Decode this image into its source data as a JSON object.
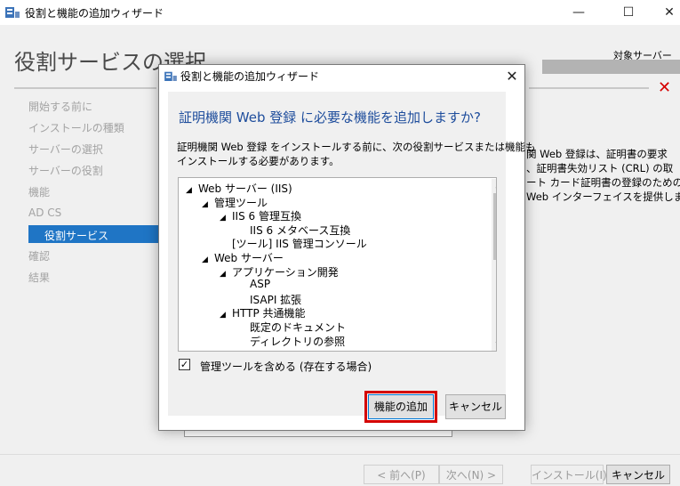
{
  "window": {
    "title": "役割と機能の追加ウィザード",
    "minimize": "—",
    "maximize": "☐",
    "close": "✕"
  },
  "page": {
    "title": "役割サービスの選択",
    "target_server_label": "対象サーバー",
    "error_icon": "✕"
  },
  "nav": {
    "items": [
      "開始する前に",
      "インストールの種類",
      "サーバーの選択",
      "サーバーの役割",
      "機能",
      "AD CS",
      "役割サービス",
      "確認",
      "結果"
    ],
    "active": "役割サービス"
  },
  "description": {
    "lines": [
      "関 Web 登録は、証明書の要求",
      "、証明書失効リスト (CRL) の取",
      "ート カード証明書の登録のための",
      "Web インターフェイスを提供しま"
    ]
  },
  "footer": {
    "prev": "< 前へ(P)",
    "next": "次へ(N) >",
    "install": "インストール(I)",
    "cancel": "キャンセル"
  },
  "dialog": {
    "title": "役割と機能の追加ウィザード",
    "close": "✕",
    "heading": "証明機関 Web 登録 に必要な機能を追加しますか?",
    "description_lines": [
      "証明機関 Web 登録 をインストールする前に、次の役割サービスまたは機能も",
      "インストールする必要があります。"
    ],
    "tree": [
      {
        "label": "Web サーバー (IIS)",
        "level": 0,
        "expanded": true
      },
      {
        "label": "管理ツール",
        "level": 1,
        "expanded": true
      },
      {
        "label": "IIS 6 管理互換",
        "level": 2,
        "expanded": true
      },
      {
        "label": "IIS 6 メタベース互換",
        "level": 3,
        "expanded": false
      },
      {
        "label": "[ツール] IIS 管理コンソール",
        "level": 2,
        "expanded": false
      },
      {
        "label": "Web サーバー",
        "level": 1,
        "expanded": true
      },
      {
        "label": "アプリケーション開発",
        "level": 2,
        "expanded": true
      },
      {
        "label": "ASP",
        "level": 3,
        "expanded": false
      },
      {
        "label": "ISAPI 拡張",
        "level": 3,
        "expanded": false
      },
      {
        "label": "HTTP 共通機能",
        "level": 2,
        "expanded": true
      },
      {
        "label": "既定のドキュメント",
        "level": 3,
        "expanded": false
      },
      {
        "label": "ディレクトリの参照",
        "level": 3,
        "expanded": false
      }
    ],
    "checkbox_label": "管理ツールを含める (存在する場合)",
    "checkbox_checked": true,
    "add_features": "機能の追加",
    "cancel": "キャンセル"
  },
  "colors": {
    "accent": "#1f75c5",
    "heading": "#1e4d9c",
    "highlight": "#d40000"
  }
}
